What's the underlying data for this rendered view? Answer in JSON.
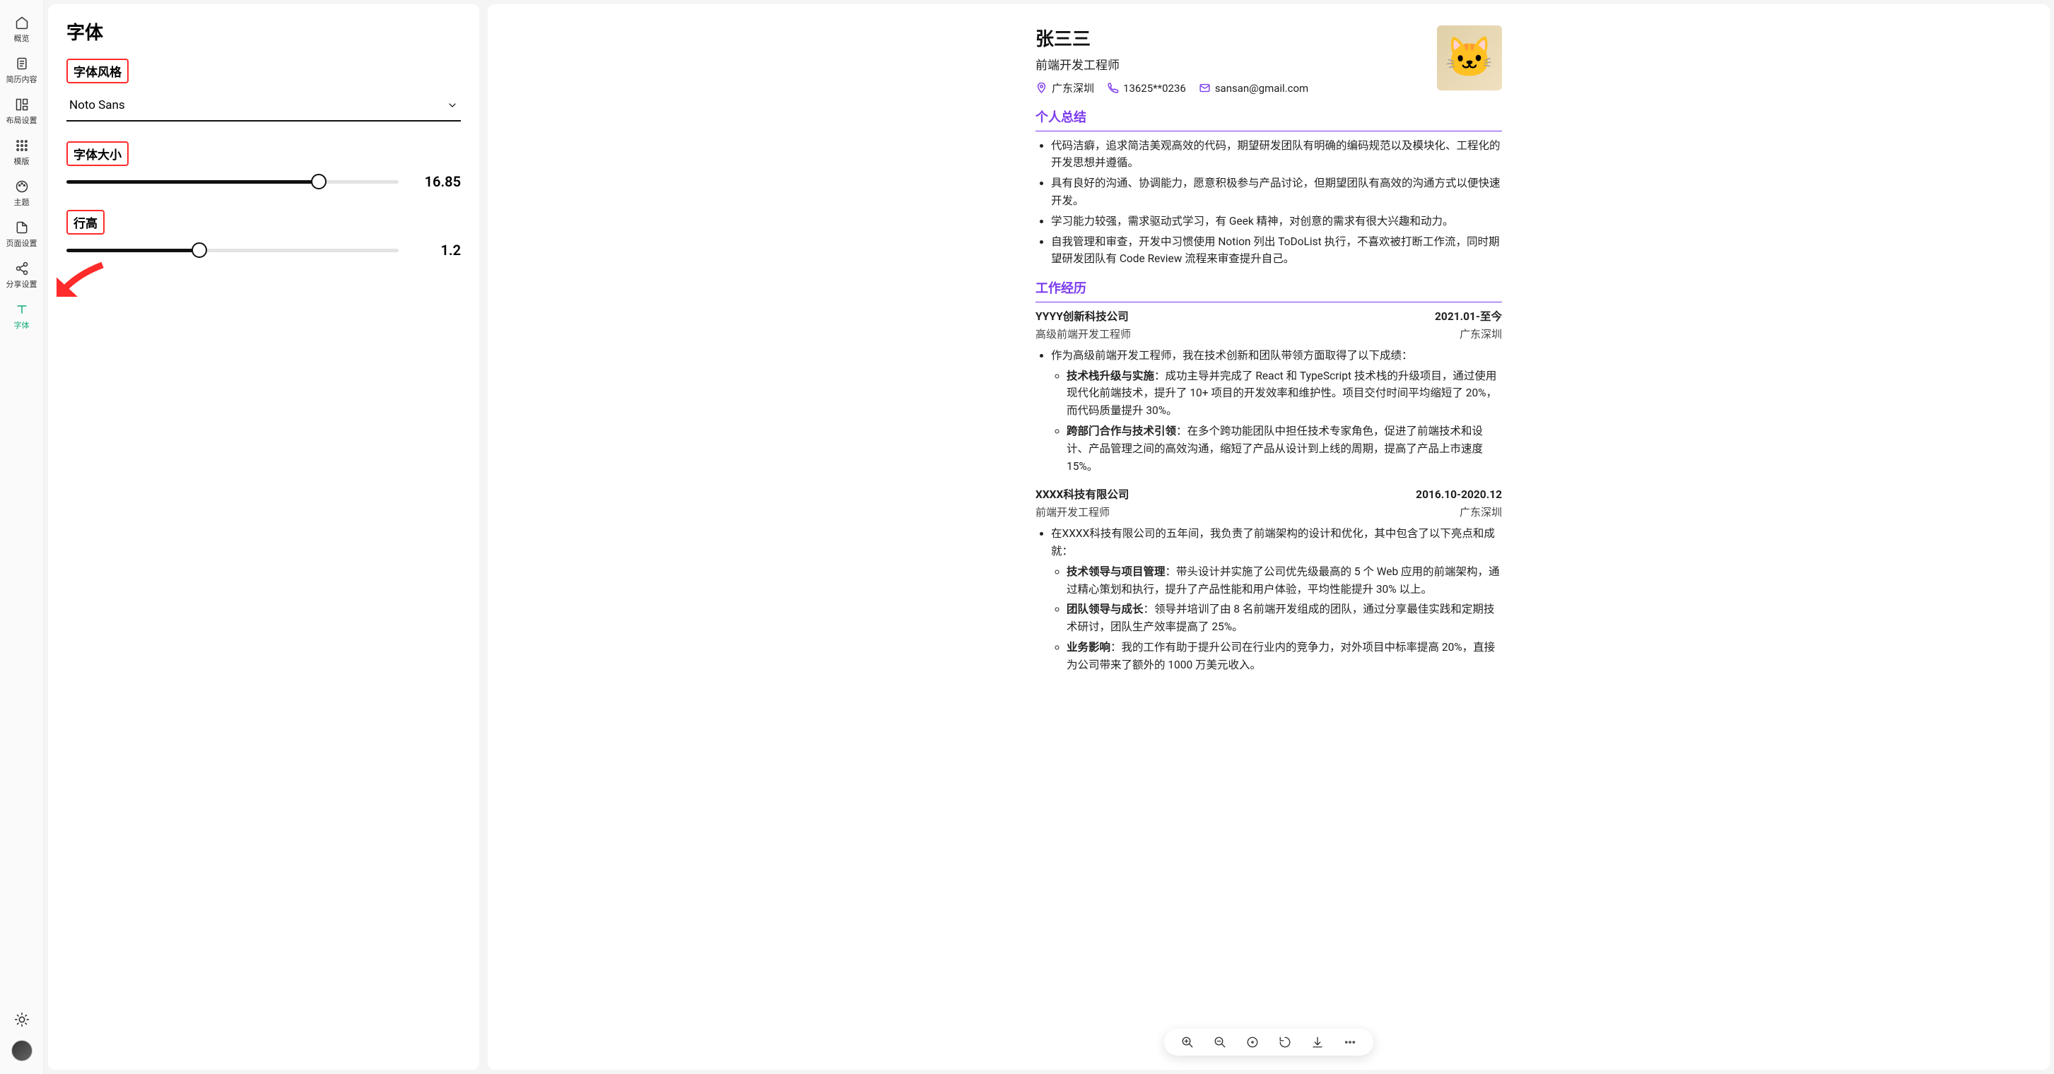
{
  "sidebar": {
    "items": [
      {
        "label": "概览"
      },
      {
        "label": "简历内容"
      },
      {
        "label": "布局设置"
      },
      {
        "label": "模版"
      },
      {
        "label": "主题"
      },
      {
        "label": "页面设置"
      },
      {
        "label": "分享设置"
      },
      {
        "label": "字体"
      }
    ]
  },
  "settings": {
    "title": "字体",
    "fontStyle": {
      "label": "字体风格",
      "value": "Noto Sans"
    },
    "fontSize": {
      "label": "字体大小",
      "value": "16.85",
      "percent": 76
    },
    "lineHeight": {
      "label": "行高",
      "value": "1.2",
      "percent": 40
    }
  },
  "resume": {
    "name": "张三三",
    "role": "前端开发工程师",
    "contact": {
      "location": "广东深圳",
      "phone": "13625**0236",
      "email": "sansan@gmail.com"
    },
    "summary": {
      "title": "个人总结",
      "items": [
        "代码洁癖，追求简洁美观高效的代码，期望研发团队有明确的编码规范以及模块化、工程化的开发思想并遵循。",
        "具有良好的沟通、协调能力，愿意积极参与产品讨论，但期望团队有高效的沟通方式以便快速开发。",
        "学习能力较强，需求驱动式学习，有 Geek 精神，对创意的需求有很大兴趣和动力。",
        "自我管理和审查，开发中习惯使用 Notion 列出 ToDoList 执行，不喜欢被打断工作流，同时期望研发团队有 Code Review 流程来审查提升自己。"
      ]
    },
    "work": {
      "title": "工作经历",
      "jobs": [
        {
          "company": "YYYY创新科技公司",
          "period": "2021.01-至今",
          "role": "高级前端开发工程师",
          "location": "广东深圳",
          "intro": "作为高级前端开发工程师，我在技术创新和团队带领方面取得了以下成绩：",
          "bullets": [
            {
              "head": "技术栈升级与实施",
              "tail": "：成功主导并完成了 React 和 TypeScript 技术栈的升级项目，通过使用现代化前端技术，提升了 10+ 项目的开发效率和维护性。项目交付时间平均缩短了 20%，而代码质量提升 30%。"
            },
            {
              "head": "跨部门合作与技术引领",
              "tail": "：在多个跨功能团队中担任技术专家角色，促进了前端技术和设计、产品管理之间的高效沟通，缩短了产品从设计到上线的周期，提高了产品上市速度 15%。"
            }
          ]
        },
        {
          "company": "XXXX科技有限公司",
          "period": "2016.10-2020.12",
          "role": "前端开发工程师",
          "location": "广东深圳",
          "intro": "在XXXX科技有限公司的五年间，我负责了前端架构的设计和优化，其中包含了以下亮点和成就：",
          "bullets": [
            {
              "head": "技术领导与项目管理",
              "tail": "：带头设计并实施了公司优先级最高的 5 个 Web 应用的前端架构，通过精心策划和执行，提升了产品性能和用户体验，平均性能提升 30% 以上。"
            },
            {
              "head": "团队领导与成长",
              "tail": "：领导并培训了由 8 名前端开发组成的团队，通过分享最佳实践和定期技术研讨，团队生产效率提高了 25%。"
            },
            {
              "head": "业务影响",
              "tail": "：我的工作有助于提升公司在行业内的竞争力，对外项目中标率提高 20%，直接为公司带来了额外的 1000 万美元收入。"
            }
          ]
        }
      ]
    }
  }
}
